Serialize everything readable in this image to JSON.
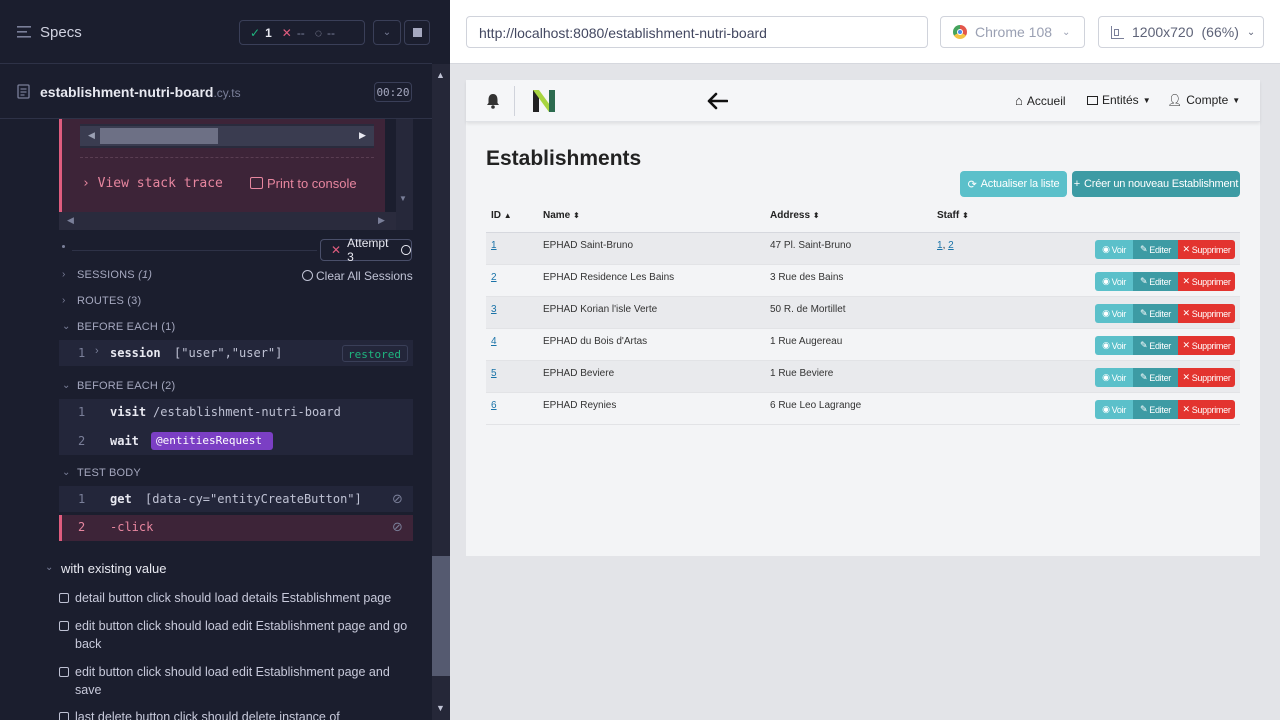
{
  "runner": {
    "specs_label": "Specs",
    "passed_count": "1",
    "failed_count": "--",
    "pending_count": "--",
    "file_name": "establishment-nutri-board",
    "file_ext": ".cy.ts",
    "duration": "00:20",
    "view_stack_trace": "View stack trace",
    "print_to_console": "Print to console",
    "attempt_label": "Attempt 3",
    "sessions_label": "SESSIONS",
    "sessions_count": "(1)",
    "clear_sessions": "Clear All Sessions",
    "routes_label": "ROUTES (3)",
    "before_each_1": "BEFORE EACH (1)",
    "session_cmd": {
      "line": "1",
      "name": "session",
      "arg": "[\"user\",\"user\"]",
      "badge": "restored"
    },
    "before_each_2": "BEFORE EACH (2)",
    "visit_cmd": {
      "line": "1",
      "name": "visit",
      "arg": "/establishment-nutri-board"
    },
    "wait_cmd": {
      "line": "2",
      "name": "wait",
      "arg": "@entitiesRequest"
    },
    "test_body": "TEST BODY",
    "get_cmd": {
      "line": "1",
      "name": "get",
      "arg": "[data-cy=\"entityCreateButton\"]"
    },
    "click_cmd": {
      "line": "2",
      "name": "-click"
    },
    "suite_title": "with existing value",
    "tests": [
      "detail button click should load details Establishment page",
      "edit button click should load edit Establishment page and go back",
      "edit button click should load edit Establishment page and save",
      "last delete button click should delete instance of"
    ]
  },
  "browser": {
    "url": "http://localhost:8080/establishment-nutri-board",
    "browser_name": "Chrome 108",
    "viewport": "1200x720",
    "zoom": "(66%)"
  },
  "app": {
    "nav": {
      "home": "Accueil",
      "entities": "Entités",
      "account": "Compte"
    },
    "page_title": "Establishments",
    "refresh_button": "Actualiser la liste",
    "create_button": "Créer un nouveau Establishment",
    "columns": {
      "id": "ID",
      "name": "Name",
      "address": "Address",
      "staff": "Staff"
    },
    "rows": [
      {
        "id": "1",
        "name": "EPHAD Saint-Bruno",
        "address": "47 Pl. Saint-Bruno",
        "staff_a": "1",
        "staff_sep": ",",
        "staff_b": "2"
      },
      {
        "id": "2",
        "name": "EPHAD Residence Les Bains",
        "address": "3 Rue des Bains",
        "staff_a": "",
        "staff_sep": "",
        "staff_b": ""
      },
      {
        "id": "3",
        "name": "EPHAD Korian l'isle Verte",
        "address": "50 R. de Mortillet",
        "staff_a": "",
        "staff_sep": "",
        "staff_b": ""
      },
      {
        "id": "4",
        "name": "EPHAD du Bois d'Artas",
        "address": "1 Rue Augereau",
        "staff_a": "",
        "staff_sep": "",
        "staff_b": ""
      },
      {
        "id": "5",
        "name": "EPHAD Beviere",
        "address": "1 Rue Beviere",
        "staff_a": "",
        "staff_sep": "",
        "staff_b": ""
      },
      {
        "id": "6",
        "name": "EPHAD Reynies",
        "address": "6 Rue Leo Lagrange",
        "staff_a": "",
        "staff_sep": "",
        "staff_b": ""
      }
    ],
    "actions": {
      "view": "Voir",
      "edit": "Editer",
      "delete": "Supprimer"
    }
  },
  "colors": {
    "pass": "#1fb57f",
    "fail": "#e05c7e",
    "wait_tag": "#7b3fc4",
    "btn_info": "#5bc0ca",
    "btn_primary": "#3d9ba4",
    "btn_danger": "#e3342f"
  }
}
